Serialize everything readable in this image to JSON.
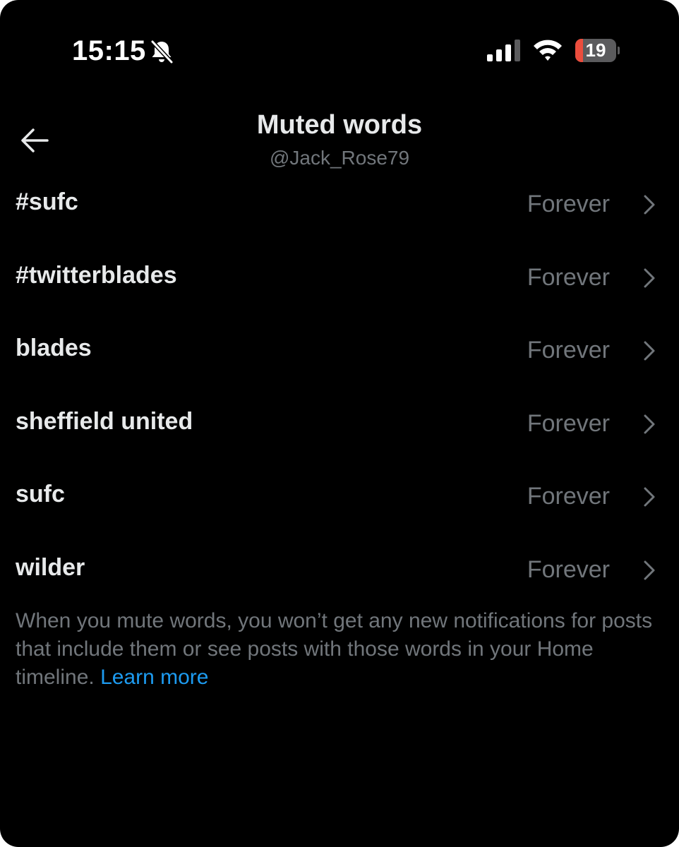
{
  "status_bar": {
    "time": "15:15",
    "battery_level": "19",
    "battery_fraction": 0.19,
    "icons": [
      "bell-slash-icon",
      "cellular-signal-icon",
      "wifi-icon",
      "battery-icon"
    ]
  },
  "header": {
    "title": "Muted words",
    "account": "@Jack_Rose79",
    "back_icon": "arrow-left-icon"
  },
  "muted_words": [
    {
      "word": "#sufc",
      "duration": "Forever"
    },
    {
      "word": "#twitterblades",
      "duration": "Forever"
    },
    {
      "word": "blades",
      "duration": "Forever"
    },
    {
      "word": "sheffield united",
      "duration": "Forever"
    },
    {
      "word": "sufc",
      "duration": "Forever"
    },
    {
      "word": "wilder",
      "duration": "Forever"
    }
  ],
  "footer": {
    "note": "When you mute words, you won’t get any new notifications for posts that include them or see posts with those words in your Home timeline.",
    "link_label": "Learn more"
  },
  "colors": {
    "background": "#000000",
    "primary_text": "#e7e9ea",
    "secondary_text": "#71767b",
    "link": "#1d9bf0",
    "battery_low": "#eb4d3d"
  }
}
